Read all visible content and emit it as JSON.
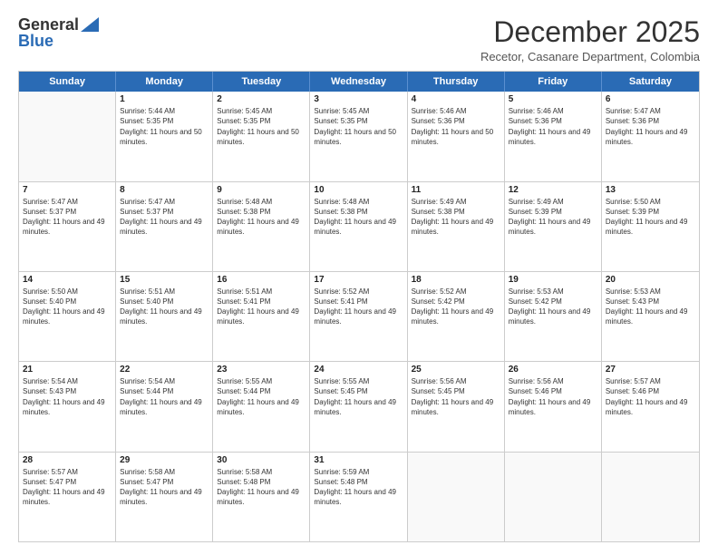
{
  "header": {
    "logo_general": "General",
    "logo_blue": "Blue",
    "month": "December 2025",
    "location": "Recetor, Casanare Department, Colombia"
  },
  "days_of_week": [
    "Sunday",
    "Monday",
    "Tuesday",
    "Wednesday",
    "Thursday",
    "Friday",
    "Saturday"
  ],
  "weeks": [
    [
      {
        "day": "",
        "empty": true
      },
      {
        "day": "1",
        "sunrise": "5:44 AM",
        "sunset": "5:35 PM",
        "daylight": "11 hours and 50 minutes."
      },
      {
        "day": "2",
        "sunrise": "5:45 AM",
        "sunset": "5:35 PM",
        "daylight": "11 hours and 50 minutes."
      },
      {
        "day": "3",
        "sunrise": "5:45 AM",
        "sunset": "5:35 PM",
        "daylight": "11 hours and 50 minutes."
      },
      {
        "day": "4",
        "sunrise": "5:46 AM",
        "sunset": "5:36 PM",
        "daylight": "11 hours and 50 minutes."
      },
      {
        "day": "5",
        "sunrise": "5:46 AM",
        "sunset": "5:36 PM",
        "daylight": "11 hours and 49 minutes."
      },
      {
        "day": "6",
        "sunrise": "5:47 AM",
        "sunset": "5:36 PM",
        "daylight": "11 hours and 49 minutes."
      }
    ],
    [
      {
        "day": "7",
        "sunrise": "5:47 AM",
        "sunset": "5:37 PM",
        "daylight": "11 hours and 49 minutes."
      },
      {
        "day": "8",
        "sunrise": "5:47 AM",
        "sunset": "5:37 PM",
        "daylight": "11 hours and 49 minutes."
      },
      {
        "day": "9",
        "sunrise": "5:48 AM",
        "sunset": "5:38 PM",
        "daylight": "11 hours and 49 minutes."
      },
      {
        "day": "10",
        "sunrise": "5:48 AM",
        "sunset": "5:38 PM",
        "daylight": "11 hours and 49 minutes."
      },
      {
        "day": "11",
        "sunrise": "5:49 AM",
        "sunset": "5:38 PM",
        "daylight": "11 hours and 49 minutes."
      },
      {
        "day": "12",
        "sunrise": "5:49 AM",
        "sunset": "5:39 PM",
        "daylight": "11 hours and 49 minutes."
      },
      {
        "day": "13",
        "sunrise": "5:50 AM",
        "sunset": "5:39 PM",
        "daylight": "11 hours and 49 minutes."
      }
    ],
    [
      {
        "day": "14",
        "sunrise": "5:50 AM",
        "sunset": "5:40 PM",
        "daylight": "11 hours and 49 minutes."
      },
      {
        "day": "15",
        "sunrise": "5:51 AM",
        "sunset": "5:40 PM",
        "daylight": "11 hours and 49 minutes."
      },
      {
        "day": "16",
        "sunrise": "5:51 AM",
        "sunset": "5:41 PM",
        "daylight": "11 hours and 49 minutes."
      },
      {
        "day": "17",
        "sunrise": "5:52 AM",
        "sunset": "5:41 PM",
        "daylight": "11 hours and 49 minutes."
      },
      {
        "day": "18",
        "sunrise": "5:52 AM",
        "sunset": "5:42 PM",
        "daylight": "11 hours and 49 minutes."
      },
      {
        "day": "19",
        "sunrise": "5:53 AM",
        "sunset": "5:42 PM",
        "daylight": "11 hours and 49 minutes."
      },
      {
        "day": "20",
        "sunrise": "5:53 AM",
        "sunset": "5:43 PM",
        "daylight": "11 hours and 49 minutes."
      }
    ],
    [
      {
        "day": "21",
        "sunrise": "5:54 AM",
        "sunset": "5:43 PM",
        "daylight": "11 hours and 49 minutes."
      },
      {
        "day": "22",
        "sunrise": "5:54 AM",
        "sunset": "5:44 PM",
        "daylight": "11 hours and 49 minutes."
      },
      {
        "day": "23",
        "sunrise": "5:55 AM",
        "sunset": "5:44 PM",
        "daylight": "11 hours and 49 minutes."
      },
      {
        "day": "24",
        "sunrise": "5:55 AM",
        "sunset": "5:45 PM",
        "daylight": "11 hours and 49 minutes."
      },
      {
        "day": "25",
        "sunrise": "5:56 AM",
        "sunset": "5:45 PM",
        "daylight": "11 hours and 49 minutes."
      },
      {
        "day": "26",
        "sunrise": "5:56 AM",
        "sunset": "5:46 PM",
        "daylight": "11 hours and 49 minutes."
      },
      {
        "day": "27",
        "sunrise": "5:57 AM",
        "sunset": "5:46 PM",
        "daylight": "11 hours and 49 minutes."
      }
    ],
    [
      {
        "day": "28",
        "sunrise": "5:57 AM",
        "sunset": "5:47 PM",
        "daylight": "11 hours and 49 minutes."
      },
      {
        "day": "29",
        "sunrise": "5:58 AM",
        "sunset": "5:47 PM",
        "daylight": "11 hours and 49 minutes."
      },
      {
        "day": "30",
        "sunrise": "5:58 AM",
        "sunset": "5:48 PM",
        "daylight": "11 hours and 49 minutes."
      },
      {
        "day": "31",
        "sunrise": "5:59 AM",
        "sunset": "5:48 PM",
        "daylight": "11 hours and 49 minutes."
      },
      {
        "day": "",
        "empty": true
      },
      {
        "day": "",
        "empty": true
      },
      {
        "day": "",
        "empty": true
      }
    ]
  ]
}
